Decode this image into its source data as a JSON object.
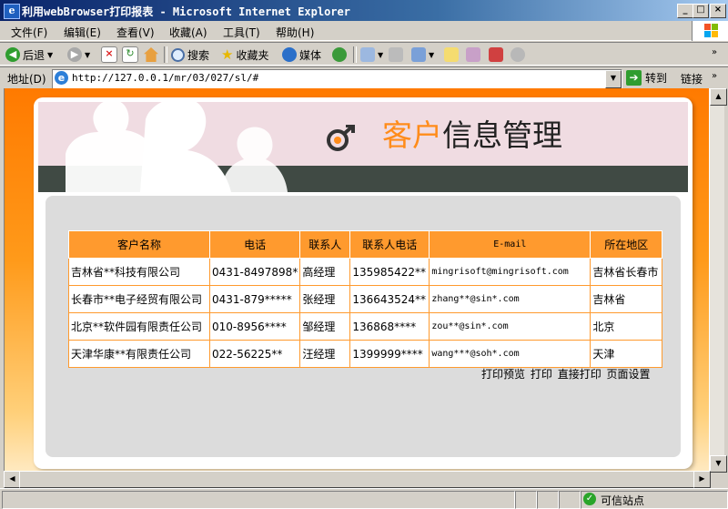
{
  "window": {
    "title": "利用webBrowser打印报表 - Microsoft Internet Explorer",
    "buttons": {
      "minimize": "_",
      "maximize": "□",
      "close": "×"
    }
  },
  "menu": {
    "items": [
      {
        "label": "文件(F)"
      },
      {
        "label": "编辑(E)"
      },
      {
        "label": "查看(V)"
      },
      {
        "label": "收藏(A)"
      },
      {
        "label": "工具(T)"
      },
      {
        "label": "帮助(H)"
      }
    ]
  },
  "toolbar": {
    "back_label": "后退",
    "search_label": "搜索",
    "favorites_label": "收藏夹",
    "media_label": "媒体"
  },
  "address": {
    "label": "地址(D)",
    "url": "http://127.0.0.1/mr/03/027/sl/#",
    "go_label": "转到",
    "links_label": "链接"
  },
  "page": {
    "header": {
      "title_accent": "客户",
      "title_rest": "信息管理"
    },
    "table": {
      "columns": [
        "客户名称",
        "电话",
        "联系人",
        "联系人电话",
        "E-mail",
        "所在地区"
      ],
      "rows": [
        [
          "吉林省**科技有限公司",
          "0431-8497898*",
          "高经理",
          "135985422**",
          "mingrisoft@mingrisoft.com",
          "吉林省长春市"
        ],
        [
          "长春市**电子经贸有限公司",
          "0431-879*****",
          "张经理",
          "136643524**",
          "zhang**@sin*.com",
          "吉林省"
        ],
        [
          "北京**软件园有限责任公司",
          "010-8956****",
          "邹经理",
          "136868****",
          "zou**@sin*.com",
          "北京"
        ],
        [
          "天津华康**有限责任公司",
          "022-56225**",
          "汪经理",
          "1399999****",
          "wang***@soh*.com",
          "天津"
        ]
      ]
    },
    "actions": {
      "print_preview": "打印预览",
      "print": "打印",
      "direct_print": "直接打印",
      "page_setup": "页面设置"
    }
  },
  "status": {
    "zone": "可信站点"
  },
  "colors": {
    "accent": "#ff8c1a",
    "table_header": "#ff9a2e",
    "banner_bar": "#404a44"
  }
}
